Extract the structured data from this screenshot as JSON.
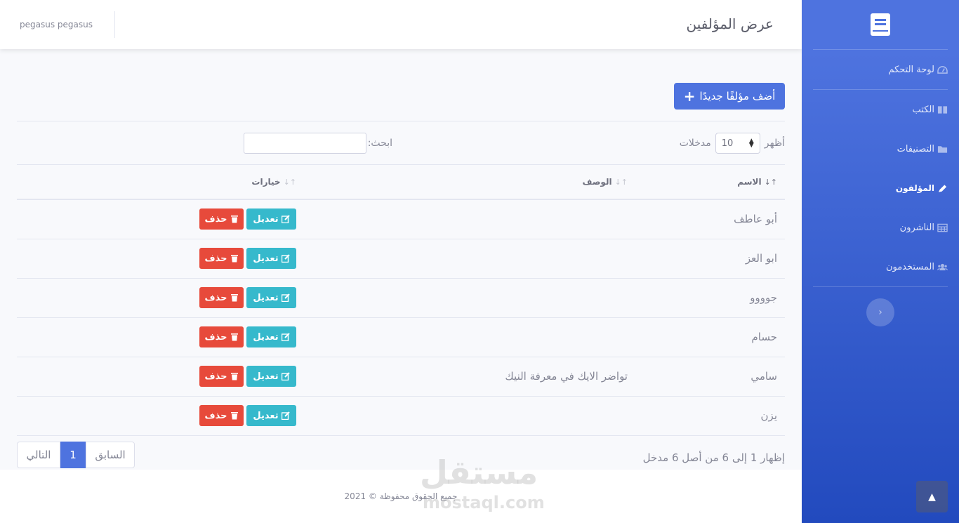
{
  "topbar": {
    "title": "عرض المؤلفين",
    "user_name": "pegasus pegasus"
  },
  "sidebar": {
    "brand_icon": "book-icon",
    "items": [
      {
        "label": "لوحة التحكم",
        "icon": "tachometer-icon",
        "active": false
      },
      {
        "label": "الكتب",
        "icon": "book-open-icon",
        "active": false
      },
      {
        "label": "التصنيفات",
        "icon": "folder-icon",
        "active": false
      },
      {
        "label": "المؤلفون",
        "icon": "pen-icon",
        "active": true
      },
      {
        "label": "الناشرون",
        "icon": "table-icon",
        "active": false
      },
      {
        "label": "المستخدمون",
        "icon": "users-icon",
        "active": false
      }
    ],
    "toggle_icon": "chevron-left-icon"
  },
  "main": {
    "add_button": "أضف مؤلفًا جديدًا",
    "show_label": "أظهر",
    "entries_label": "مدخلات",
    "page_size": "10",
    "search_label": "ابحث:",
    "search_value": "",
    "table": {
      "headers": {
        "name": "الاسم",
        "description": "الوصف",
        "options": "خيارات"
      },
      "rows": [
        {
          "name": "أبو عاطف",
          "description": ""
        },
        {
          "name": "ابو العز",
          "description": ""
        },
        {
          "name": "جوووو",
          "description": ""
        },
        {
          "name": "حسام",
          "description": ""
        },
        {
          "name": "سامي",
          "description": "تواضر الايك في معرفة النيك"
        },
        {
          "name": "يزن",
          "description": ""
        }
      ],
      "edit_label": "تعديل",
      "delete_label": "حذف"
    },
    "info": "إظهار 1 إلى 6 من أصل 6 مدخل",
    "pagination": {
      "previous": "السابق",
      "current": "1",
      "next": "التالي"
    }
  },
  "footer": {
    "copyright": "جميع الحقوق محفوظة © 2021"
  },
  "watermark": {
    "arabic": "مستقل",
    "latin": "mostaql.com"
  },
  "colors": {
    "primary": "#4e73df",
    "info": "#36b9cc",
    "danger": "#e74a3b"
  }
}
